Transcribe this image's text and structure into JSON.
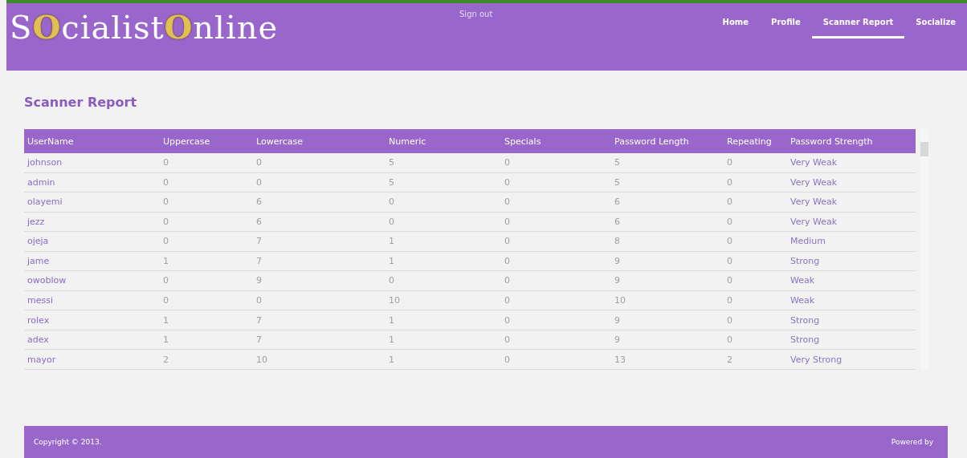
{
  "header": {
    "logo": [
      {
        "text": "S",
        "kind": "plain"
      },
      {
        "text": "O",
        "kind": "ring"
      },
      {
        "text": "cialist",
        "kind": "plain"
      },
      {
        "text": "O",
        "kind": "ring"
      },
      {
        "text": "nline",
        "kind": "plain"
      }
    ],
    "sign_out": "Sign out",
    "nav": [
      {
        "label": "Home",
        "selected": false
      },
      {
        "label": "Profile",
        "selected": false
      },
      {
        "label": "Scanner Report",
        "selected": true
      },
      {
        "label": "Socialize",
        "selected": false
      }
    ]
  },
  "page_title": "Scanner Report",
  "table": {
    "columns": [
      "UserName",
      "Uppercase",
      "Lowercase",
      "Numeric",
      "Specials",
      "Password Length",
      "Repeating",
      "Password Strength"
    ],
    "rows": [
      [
        "johnson",
        "0",
        "0",
        "5",
        "0",
        "5",
        "0",
        "Very Weak"
      ],
      [
        "admin",
        "0",
        "0",
        "5",
        "0",
        "5",
        "0",
        "Very Weak"
      ],
      [
        "olayemi",
        "0",
        "6",
        "0",
        "0",
        "6",
        "0",
        "Very Weak"
      ],
      [
        "jezz",
        "0",
        "6",
        "0",
        "0",
        "6",
        "0",
        "Very Weak"
      ],
      [
        "ojeja",
        "0",
        "7",
        "1",
        "0",
        "8",
        "0",
        "Medium"
      ],
      [
        "jame",
        "1",
        "7",
        "1",
        "0",
        "9",
        "0",
        "Strong"
      ],
      [
        "owoblow",
        "0",
        "9",
        "0",
        "0",
        "9",
        "0",
        "Weak"
      ],
      [
        "messi",
        "0",
        "0",
        "10",
        "0",
        "10",
        "0",
        "Weak"
      ],
      [
        "rolex",
        "1",
        "7",
        "1",
        "0",
        "9",
        "0",
        "Strong"
      ],
      [
        "adex",
        "1",
        "7",
        "1",
        "0",
        "9",
        "0",
        "Strong"
      ],
      [
        "mayor",
        "2",
        "10",
        "1",
        "0",
        "13",
        "2",
        "Very Strong"
      ]
    ]
  },
  "footer": {
    "copyright": "Copyright © 2013.",
    "powered_by": "Powered by"
  }
}
